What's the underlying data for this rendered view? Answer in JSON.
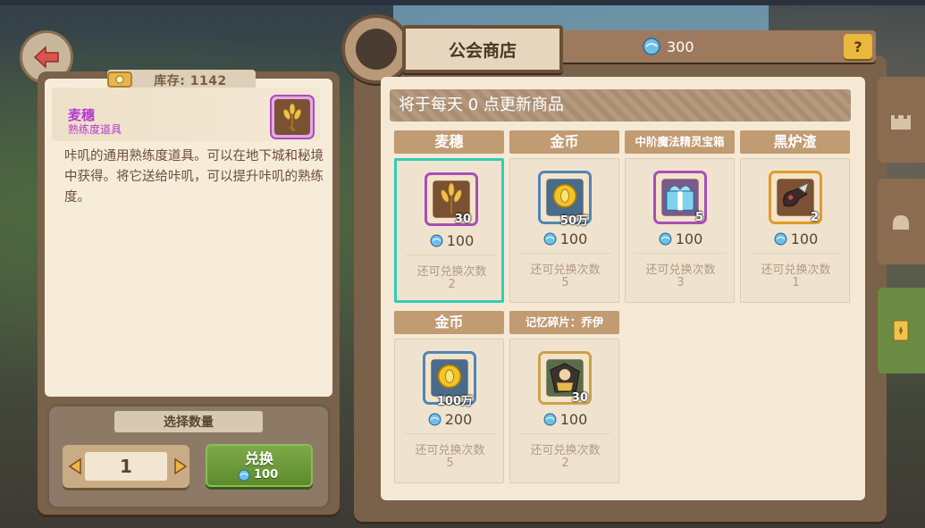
{
  "left": {
    "stock_label": "库存: 1142",
    "item_name": "麦穗",
    "item_type": "熟练度道具",
    "description": "咔叽的通用熟练度道具。可以在地下城和秘境中获得。将它送给咔叽，可以提升咔叽的熟练度。",
    "quantity_title": "选择数量",
    "quantity_value": "1",
    "exchange_label": "兑换",
    "exchange_price": "100"
  },
  "header": {
    "title": "公会商店",
    "currency_amount": "300",
    "help_label": "?"
  },
  "notice": "将于每天 0 点更新商品",
  "remain_label": "还可兑换次数",
  "items": [
    {
      "name": "麦穗",
      "qty": "30",
      "price": "100",
      "remaining": "2",
      "icon": "wheat-icon",
      "frame": "#a64fb8"
    },
    {
      "name": "金币",
      "qty": "50万",
      "price": "100",
      "remaining": "5",
      "icon": "gold-coin-icon",
      "frame": "#4f86b6"
    },
    {
      "name": "中阶魔法精灵宝箱",
      "qty": "5",
      "price": "100",
      "remaining": "3",
      "icon": "gift-chest-icon",
      "frame": "#a64fb8"
    },
    {
      "name": "黑炉渣",
      "qty": "2",
      "price": "100",
      "remaining": "1",
      "icon": "slag-icon",
      "frame": "#e09a2a"
    },
    {
      "name": "金币",
      "qty": "100万",
      "price": "200",
      "remaining": "5",
      "icon": "gold-coin-icon",
      "frame": "#4f86b6"
    },
    {
      "name": "记忆碎片：乔伊",
      "qty": "30",
      "price": "100",
      "remaining": "2",
      "icon": "memory-fragment-icon",
      "frame": "#c9a24a"
    }
  ],
  "colors": {
    "accent_select": "#32cdb4",
    "button_green": "#6f9c3d",
    "card_header": "#c19b72",
    "item_name_purple": "#b33bd0"
  }
}
